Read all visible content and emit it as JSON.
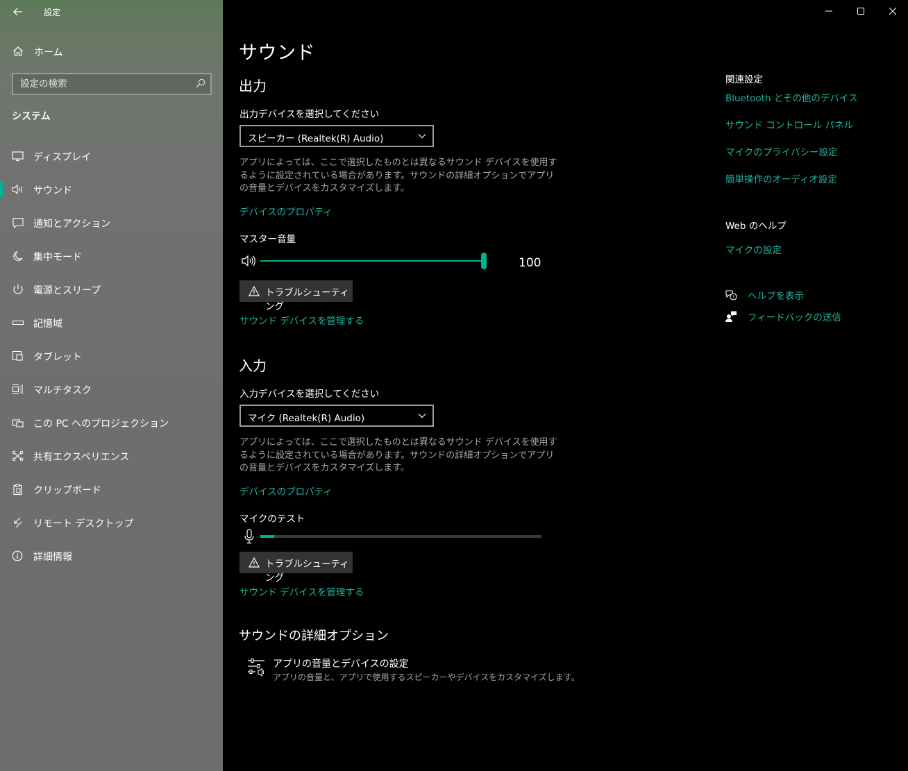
{
  "window": {
    "title": "設定"
  },
  "sidebar": {
    "home_label": "ホーム",
    "search_placeholder": "設定の検索",
    "section_label": "システム",
    "items": [
      {
        "label": "ディスプレイ",
        "icon": "display-icon"
      },
      {
        "label": "サウンド",
        "icon": "speaker-icon",
        "active": true
      },
      {
        "label": "通知とアクション",
        "icon": "notification-icon"
      },
      {
        "label": "集中モード",
        "icon": "moon-icon"
      },
      {
        "label": "電源とスリープ",
        "icon": "power-icon"
      },
      {
        "label": "記憶域",
        "icon": "storage-icon"
      },
      {
        "label": "タブレット",
        "icon": "tablet-icon"
      },
      {
        "label": "マルチタスク",
        "icon": "multitask-icon"
      },
      {
        "label": "この PC へのプロジェクション",
        "icon": "projection-icon"
      },
      {
        "label": "共有エクスペリエンス",
        "icon": "shared-icon"
      },
      {
        "label": "クリップボード",
        "icon": "clipboard-icon"
      },
      {
        "label": "リモート デスクトップ",
        "icon": "remote-desktop-icon"
      },
      {
        "label": "詳細情報",
        "icon": "info-icon"
      }
    ]
  },
  "main": {
    "page_title": "サウンド",
    "output": {
      "heading": "出力",
      "select_label": "出力デバイスを選択してください",
      "selected_device": "スピーカー (Realtek(R) Audio)",
      "description": "アプリによっては、ここで選択したものとは異なるサウンド デバイスを使用するように設定されている場合があります。サウンドの詳細オプションでアプリの音量とデバイスをカスタマイズします。",
      "properties_link": "デバイスのプロパティ",
      "volume_label": "マスター音量",
      "volume_value": "100",
      "volume_fraction": 1.0,
      "troubleshoot_label": "トラブルシューティング",
      "manage_link": "サウンド デバイスを管理する"
    },
    "input": {
      "heading": "入力",
      "select_label": "入力デバイスを選択してください",
      "selected_device": "マイク (Realtek(R) Audio)",
      "description": "アプリによっては、ここで選択したものとは異なるサウンド デバイスを使用するように設定されている場合があります。サウンドの詳細オプションでアプリの音量とデバイスをカスタマイズします。",
      "properties_link": "デバイスのプロパティ",
      "test_label": "マイクのテスト",
      "mic_level_fraction": 0.05,
      "troubleshoot_label": "トラブルシューティング",
      "manage_link": "サウンド デバイスを管理する"
    },
    "advanced": {
      "heading": "サウンドの詳細オプション",
      "item_title": "アプリの音量とデバイスの設定",
      "item_desc": "アプリの音量と、アプリで使用するスピーカーやデバイスをカスタマイズします。"
    }
  },
  "related": {
    "heading": "関連設定",
    "links": [
      "Bluetooth とその他のデバイス",
      "サウンド コントロール パネル",
      "マイクのプライバシー設定",
      "簡単操作のオーディオ設定"
    ],
    "web_help_heading": "Web のヘルプ",
    "web_help_link": "マイクの設定",
    "get_help": "ヘルプを表示",
    "feedback": "フィードバックの送信"
  },
  "colors": {
    "accent": "#00b294",
    "link": "#1fb59e"
  }
}
